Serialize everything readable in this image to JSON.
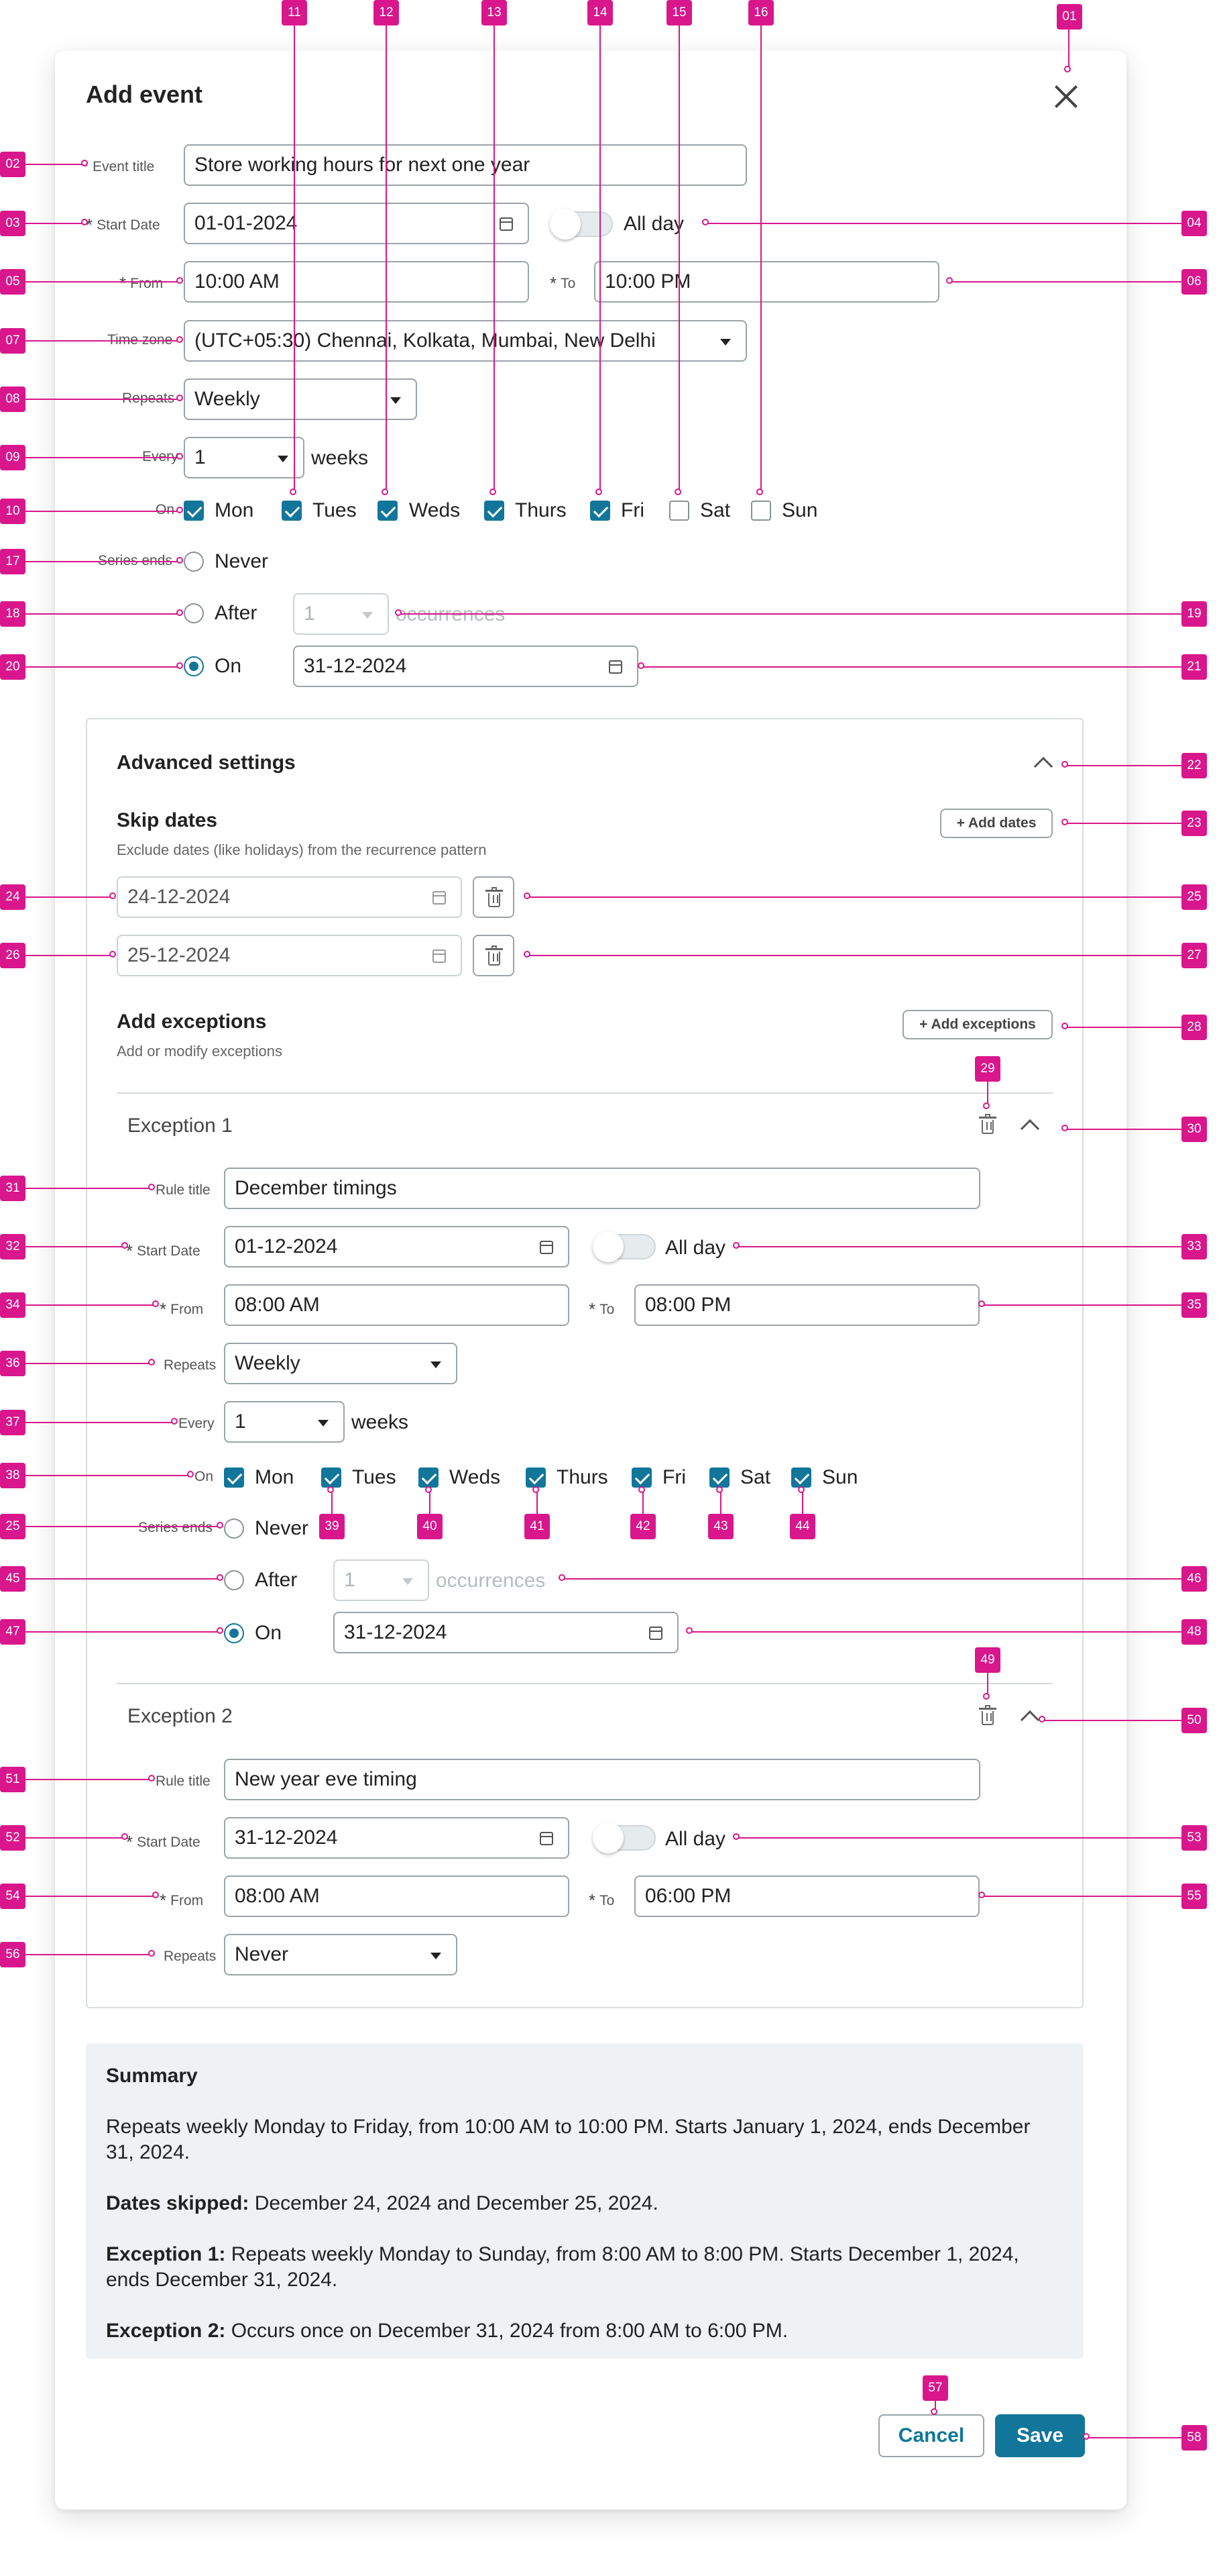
{
  "dialog": {
    "title": "Add event",
    "close_label": "Close"
  },
  "event": {
    "title_label": "Event title",
    "title_value": "Store working hours for next one year",
    "start_label": "Start Date",
    "start_value": "01-01-2024",
    "allday_label": "All day",
    "from_label": "From",
    "from_value": "10:00 AM",
    "to_label": "To",
    "to_value": "10:00 PM",
    "tz_label": "Time zone",
    "tz_value": "(UTC+05:30) Chennai, Kolkata, Mumbai, New Delhi",
    "repeats_label": "Repeats",
    "repeats_value": "Weekly",
    "every_label": "Every",
    "every_value": "1",
    "every_unit": "weeks",
    "on_label": "On",
    "days": [
      {
        "label": "Mon",
        "checked": true
      },
      {
        "label": "Tues",
        "checked": true
      },
      {
        "label": "Weds",
        "checked": true
      },
      {
        "label": "Thurs",
        "checked": true
      },
      {
        "label": "Fri",
        "checked": true
      },
      {
        "label": "Sat",
        "checked": false
      },
      {
        "label": "Sun",
        "checked": false
      }
    ],
    "ends_label": "Series ends",
    "never_label": "Never",
    "after_label": "After",
    "after_value": "1",
    "occurrences_label": "occurrences",
    "on_end_label": "On",
    "end_date": "31-12-2024",
    "ends_selected": "On"
  },
  "advanced": {
    "title": "Advanced settings",
    "skip_title": "Skip dates",
    "skip_sub": "Exclude dates (like holidays) from the recurrence pattern",
    "add_dates": "+ Add dates",
    "skip_dates": [
      "24-12-2024",
      "25-12-2024"
    ],
    "exc_title": "Add exceptions",
    "exc_sub": "Add or modify exceptions",
    "add_exceptions": "+ Add exceptions",
    "exception1": {
      "header": "Exception 1",
      "rule_label": "Rule title",
      "rule_value": "December timings",
      "start_label": "Start Date",
      "start_value": "01-12-2024",
      "allday_label": "All day",
      "from_label": "From",
      "from_value": "08:00 AM",
      "to_label": "To",
      "to_value": "08:00 PM",
      "repeats_label": "Repeats",
      "repeats_value": "Weekly",
      "every_label": "Every",
      "every_value": "1",
      "every_unit": "weeks",
      "on_label": "On",
      "days": [
        {
          "label": "Mon",
          "checked": true
        },
        {
          "label": "Tues",
          "checked": true
        },
        {
          "label": "Weds",
          "checked": true
        },
        {
          "label": "Thurs",
          "checked": true
        },
        {
          "label": "Fri",
          "checked": true
        },
        {
          "label": "Sat",
          "checked": true
        },
        {
          "label": "Sun",
          "checked": true
        }
      ],
      "ends_label": "Series ends",
      "never_label": "Never",
      "after_label": "After",
      "after_value": "1",
      "occurrences_label": "occurrences",
      "on_end_label": "On",
      "end_date": "31-12-2024"
    },
    "exception2": {
      "header": "Exception 2",
      "rule_label": "Rule title",
      "rule_value": "New year eve timing",
      "start_label": "Start Date",
      "start_value": "31-12-2024",
      "allday_label": "All day",
      "from_label": "From",
      "from_value": "08:00 AM",
      "to_label": "To",
      "to_value": "06:00 PM",
      "repeats_label": "Repeats",
      "repeats_value": "Never"
    }
  },
  "summary": {
    "title": "Summary",
    "line1": "Repeats weekly Monday to Friday, from 10:00 AM to 10:00 PM. Starts January 1, 2024, ends December 31, 2024.",
    "skipped_label": "Dates skipped:",
    "skipped_text": " December 24, 2024 and December 25, 2024.",
    "exc1_label": "Exception 1:",
    "exc1_text": " Repeats weekly Monday to Sunday, from 8:00 AM to 8:00 PM. Starts December 1, 2024, ends December 31, 2024.",
    "exc2_label": "Exception 2:",
    "exc2_text": " Occurs once on December 31, 2024 from 8:00 AM to 6:00 PM."
  },
  "footer": {
    "cancel": "Cancel",
    "save": "Save"
  },
  "annotations": [
    "01",
    "02",
    "03",
    "04",
    "05",
    "06",
    "07",
    "08",
    "09",
    "10",
    "11",
    "12",
    "13",
    "14",
    "15",
    "16",
    "17",
    "18",
    "19",
    "20",
    "21",
    "22",
    "23",
    "24",
    "25",
    "26",
    "27",
    "28",
    "29",
    "30",
    "31",
    "32",
    "33",
    "34",
    "35",
    "36",
    "37",
    "38",
    "25",
    "39",
    "40",
    "41",
    "42",
    "43",
    "44",
    "45",
    "46",
    "47",
    "48",
    "49",
    "50",
    "51",
    "52",
    "53",
    "54",
    "55",
    "56",
    "57",
    "58"
  ],
  "colors": {
    "accent": "#11769a",
    "annotation": "#d9168b",
    "summary_bg": "#eef2f4"
  }
}
